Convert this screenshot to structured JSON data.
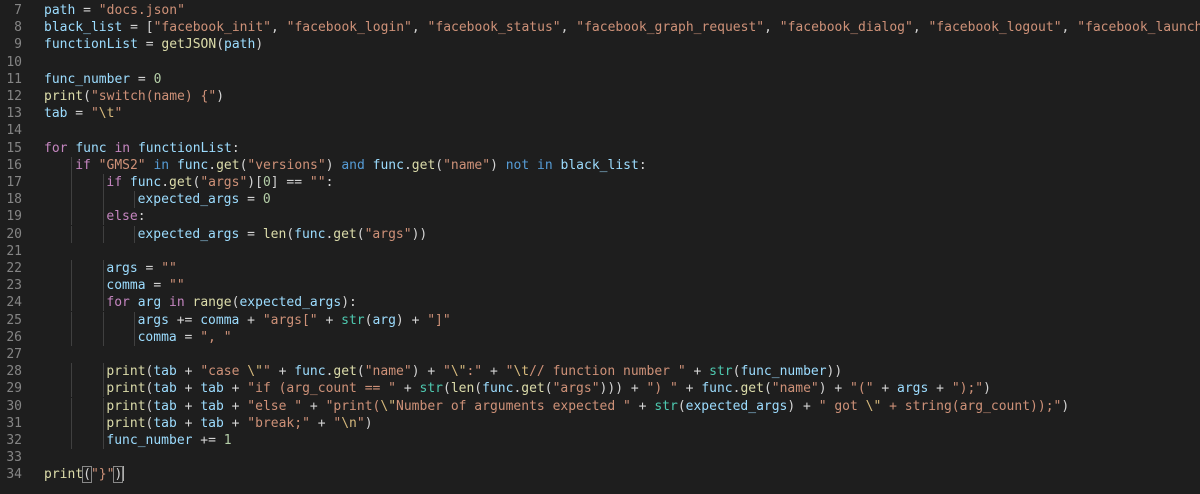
{
  "editor": {
    "line_numbers": [
      "7",
      "8",
      "9",
      "10",
      "11",
      "12",
      "13",
      "14",
      "15",
      "16",
      "17",
      "18",
      "19",
      "20",
      "21",
      "22",
      "23",
      "24",
      "25",
      "26",
      "27",
      "28",
      "29",
      "30",
      "31",
      "32",
      "33",
      "34"
    ],
    "lines": [
      {
        "indent": 0,
        "tokens": [
          [
            "path",
            "var"
          ],
          [
            " = ",
            "op"
          ],
          [
            "\"docs.json\"",
            "str"
          ]
        ]
      },
      {
        "indent": 0,
        "tokens": [
          [
            "black_list",
            "var"
          ],
          [
            " = [",
            "op"
          ],
          [
            "\"facebook_init\"",
            "str"
          ],
          [
            ", ",
            "op"
          ],
          [
            "\"facebook_login\"",
            "str"
          ],
          [
            ", ",
            "op"
          ],
          [
            "\"facebook_status\"",
            "str"
          ],
          [
            ", ",
            "op"
          ],
          [
            "\"facebook_graph_request\"",
            "str"
          ],
          [
            ", ",
            "op"
          ],
          [
            "\"facebook_dialog\"",
            "str"
          ],
          [
            ", ",
            "op"
          ],
          [
            "\"facebook_logout\"",
            "str"
          ],
          [
            ", ",
            "op"
          ],
          [
            "\"facebook_launch_offerwall\"",
            "str"
          ],
          [
            ", ",
            "op"
          ],
          [
            "\"facebo",
            "str"
          ]
        ]
      },
      {
        "indent": 0,
        "tokens": [
          [
            "functionList",
            "var"
          ],
          [
            " = ",
            "op"
          ],
          [
            "getJSON",
            "fn"
          ],
          [
            "(",
            "op"
          ],
          [
            "path",
            "var"
          ],
          [
            ")",
            "op"
          ]
        ]
      },
      {
        "indent": 0,
        "tokens": []
      },
      {
        "indent": 0,
        "tokens": [
          [
            "func_number",
            "var"
          ],
          [
            " = ",
            "op"
          ],
          [
            "0",
            "num"
          ]
        ]
      },
      {
        "indent": 0,
        "tokens": [
          [
            "print",
            "fn"
          ],
          [
            "(",
            "op"
          ],
          [
            "\"switch(name) {\"",
            "str"
          ],
          [
            ")",
            "op"
          ]
        ]
      },
      {
        "indent": 0,
        "tokens": [
          [
            "tab",
            "var"
          ],
          [
            " = ",
            "op"
          ],
          [
            "\"",
            "str"
          ],
          [
            "\\t",
            "esc"
          ],
          [
            "\"",
            "str"
          ]
        ]
      },
      {
        "indent": 0,
        "tokens": []
      },
      {
        "indent": 0,
        "tokens": [
          [
            "for",
            "kw2"
          ],
          [
            " ",
            "op"
          ],
          [
            "func",
            "var"
          ],
          [
            " ",
            "op"
          ],
          [
            "in",
            "kw2"
          ],
          [
            " ",
            "op"
          ],
          [
            "functionList",
            "var"
          ],
          [
            ":",
            "op"
          ]
        ]
      },
      {
        "indent": 1,
        "tokens": [
          [
            "if",
            "kw2"
          ],
          [
            " ",
            "op"
          ],
          [
            "\"GMS2\"",
            "str"
          ],
          [
            " ",
            "op"
          ],
          [
            "in",
            "kw"
          ],
          [
            " ",
            "op"
          ],
          [
            "func",
            "var"
          ],
          [
            ".",
            "op"
          ],
          [
            "get",
            "fn"
          ],
          [
            "(",
            "op"
          ],
          [
            "\"versions\"",
            "str"
          ],
          [
            ") ",
            "op"
          ],
          [
            "and",
            "kw"
          ],
          [
            " ",
            "op"
          ],
          [
            "func",
            "var"
          ],
          [
            ".",
            "op"
          ],
          [
            "get",
            "fn"
          ],
          [
            "(",
            "op"
          ],
          [
            "\"name\"",
            "str"
          ],
          [
            ") ",
            "op"
          ],
          [
            "not in",
            "kw"
          ],
          [
            " ",
            "op"
          ],
          [
            "black_list",
            "var"
          ],
          [
            ":",
            "op"
          ]
        ]
      },
      {
        "indent": 2,
        "tokens": [
          [
            "if",
            "kw2"
          ],
          [
            " ",
            "op"
          ],
          [
            "func",
            "var"
          ],
          [
            ".",
            "op"
          ],
          [
            "get",
            "fn"
          ],
          [
            "(",
            "op"
          ],
          [
            "\"args\"",
            "str"
          ],
          [
            ")[",
            "op"
          ],
          [
            "0",
            "num"
          ],
          [
            "] == ",
            "op"
          ],
          [
            "\"\"",
            "str"
          ],
          [
            ":",
            "op"
          ]
        ]
      },
      {
        "indent": 3,
        "tokens": [
          [
            "expected_args",
            "var"
          ],
          [
            " = ",
            "op"
          ],
          [
            "0",
            "num"
          ]
        ]
      },
      {
        "indent": 2,
        "tokens": [
          [
            "else",
            "kw2"
          ],
          [
            ":",
            "op"
          ]
        ]
      },
      {
        "indent": 3,
        "tokens": [
          [
            "expected_args",
            "var"
          ],
          [
            " = ",
            "op"
          ],
          [
            "len",
            "fn"
          ],
          [
            "(",
            "op"
          ],
          [
            "func",
            "var"
          ],
          [
            ".",
            "op"
          ],
          [
            "get",
            "fn"
          ],
          [
            "(",
            "op"
          ],
          [
            "\"args\"",
            "str"
          ],
          [
            "))",
            "op"
          ]
        ]
      },
      {
        "indent": 0,
        "tokens": []
      },
      {
        "indent": 2,
        "tokens": [
          [
            "args",
            "var"
          ],
          [
            " = ",
            "op"
          ],
          [
            "\"\"",
            "str"
          ]
        ]
      },
      {
        "indent": 2,
        "tokens": [
          [
            "comma",
            "var"
          ],
          [
            " = ",
            "op"
          ],
          [
            "\"\"",
            "str"
          ]
        ]
      },
      {
        "indent": 2,
        "tokens": [
          [
            "for",
            "kw2"
          ],
          [
            " ",
            "op"
          ],
          [
            "arg",
            "var"
          ],
          [
            " ",
            "op"
          ],
          [
            "in",
            "kw2"
          ],
          [
            " ",
            "op"
          ],
          [
            "range",
            "fn"
          ],
          [
            "(",
            "op"
          ],
          [
            "expected_args",
            "var"
          ],
          [
            "):",
            "op"
          ]
        ]
      },
      {
        "indent": 3,
        "tokens": [
          [
            "args",
            "var"
          ],
          [
            " += ",
            "op"
          ],
          [
            "comma",
            "var"
          ],
          [
            " + ",
            "op"
          ],
          [
            "\"args[\"",
            "str"
          ],
          [
            " + ",
            "op"
          ],
          [
            "str",
            "bi"
          ],
          [
            "(",
            "op"
          ],
          [
            "arg",
            "var"
          ],
          [
            ") + ",
            "op"
          ],
          [
            "\"]\"",
            "str"
          ]
        ]
      },
      {
        "indent": 3,
        "tokens": [
          [
            "comma",
            "var"
          ],
          [
            " = ",
            "op"
          ],
          [
            "\", \"",
            "str"
          ]
        ]
      },
      {
        "indent": 0,
        "tokens": []
      },
      {
        "indent": 2,
        "tokens": [
          [
            "print",
            "fn"
          ],
          [
            "(",
            "op"
          ],
          [
            "tab",
            "var"
          ],
          [
            " + ",
            "op"
          ],
          [
            "\"case ",
            "str"
          ],
          [
            "\\\"",
            "esc"
          ],
          [
            "\"",
            "str"
          ],
          [
            " + ",
            "op"
          ],
          [
            "func",
            "var"
          ],
          [
            ".",
            "op"
          ],
          [
            "get",
            "fn"
          ],
          [
            "(",
            "op"
          ],
          [
            "\"name\"",
            "str"
          ],
          [
            ") + ",
            "op"
          ],
          [
            "\"",
            "str"
          ],
          [
            "\\\"",
            "esc"
          ],
          [
            ":\"",
            "str"
          ],
          [
            " + ",
            "op"
          ],
          [
            "\"",
            "str"
          ],
          [
            "\\t",
            "esc"
          ],
          [
            "// function number \"",
            "str"
          ],
          [
            " + ",
            "op"
          ],
          [
            "str",
            "bi"
          ],
          [
            "(",
            "op"
          ],
          [
            "func_number",
            "var"
          ],
          [
            "))",
            "op"
          ]
        ]
      },
      {
        "indent": 2,
        "tokens": [
          [
            "print",
            "fn"
          ],
          [
            "(",
            "op"
          ],
          [
            "tab",
            "var"
          ],
          [
            " + ",
            "op"
          ],
          [
            "tab",
            "var"
          ],
          [
            " + ",
            "op"
          ],
          [
            "\"if (arg_count == \"",
            "str"
          ],
          [
            " + ",
            "op"
          ],
          [
            "str",
            "bi"
          ],
          [
            "(",
            "op"
          ],
          [
            "len",
            "fn"
          ],
          [
            "(",
            "op"
          ],
          [
            "func",
            "var"
          ],
          [
            ".",
            "op"
          ],
          [
            "get",
            "fn"
          ],
          [
            "(",
            "op"
          ],
          [
            "\"args\"",
            "str"
          ],
          [
            "))) + ",
            "op"
          ],
          [
            "\") \"",
            "str"
          ],
          [
            " + ",
            "op"
          ],
          [
            "func",
            "var"
          ],
          [
            ".",
            "op"
          ],
          [
            "get",
            "fn"
          ],
          [
            "(",
            "op"
          ],
          [
            "\"name\"",
            "str"
          ],
          [
            ") + ",
            "op"
          ],
          [
            "\"(\"",
            "str"
          ],
          [
            " + ",
            "op"
          ],
          [
            "args",
            "var"
          ],
          [
            " + ",
            "op"
          ],
          [
            "\");\"",
            "str"
          ],
          [
            ")",
            "op"
          ]
        ]
      },
      {
        "indent": 2,
        "tokens": [
          [
            "print",
            "fn"
          ],
          [
            "(",
            "op"
          ],
          [
            "tab",
            "var"
          ],
          [
            " + ",
            "op"
          ],
          [
            "tab",
            "var"
          ],
          [
            " + ",
            "op"
          ],
          [
            "\"else \"",
            "str"
          ],
          [
            " + ",
            "op"
          ],
          [
            "\"print(",
            "str"
          ],
          [
            "\\\"",
            "esc"
          ],
          [
            "Number of arguments expected \"",
            "str"
          ],
          [
            " + ",
            "op"
          ],
          [
            "str",
            "bi"
          ],
          [
            "(",
            "op"
          ],
          [
            "expected_args",
            "var"
          ],
          [
            ") + ",
            "op"
          ],
          [
            "\" got ",
            "str"
          ],
          [
            "\\\"",
            "esc"
          ],
          [
            " + string(arg_count));\"",
            "str"
          ],
          [
            ")",
            "op"
          ]
        ]
      },
      {
        "indent": 2,
        "tokens": [
          [
            "print",
            "fn"
          ],
          [
            "(",
            "op"
          ],
          [
            "tab",
            "var"
          ],
          [
            " + ",
            "op"
          ],
          [
            "tab",
            "var"
          ],
          [
            " + ",
            "op"
          ],
          [
            "\"break;\"",
            "str"
          ],
          [
            " + ",
            "op"
          ],
          [
            "\"",
            "str"
          ],
          [
            "\\n",
            "esc"
          ],
          [
            "\"",
            "str"
          ],
          [
            ")",
            "op"
          ]
        ]
      },
      {
        "indent": 2,
        "tokens": [
          [
            "func_number",
            "var"
          ],
          [
            " += ",
            "op"
          ],
          [
            "1",
            "num"
          ]
        ]
      },
      {
        "indent": 0,
        "tokens": []
      },
      {
        "indent": 0,
        "tokens": [
          [
            "print",
            "fn"
          ],
          [
            "(",
            "bm"
          ],
          [
            "\"}\"",
            "str"
          ],
          [
            ")",
            "bm"
          ]
        ],
        "cursor": true
      }
    ]
  },
  "colors": {
    "background": "#1e1e1e",
    "line_number": "#858585",
    "keyword": "#569cd6",
    "control_keyword": "#c586c0",
    "string": "#ce9178",
    "function": "#dcdcaa",
    "number": "#b5cea8",
    "variable": "#9cdcfe",
    "builtin": "#4ec9b0",
    "escape": "#d7ba7d"
  }
}
